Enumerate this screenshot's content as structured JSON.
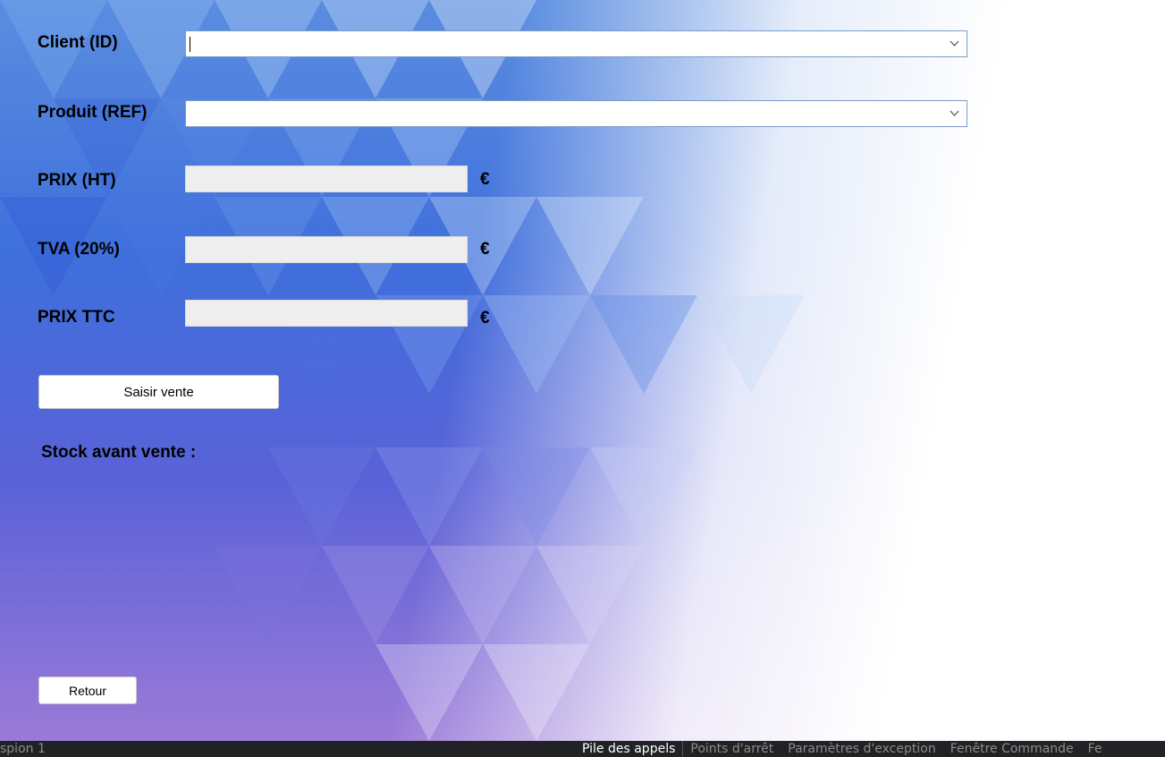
{
  "form": {
    "client_label": "Client (ID)",
    "client_value": "",
    "produit_label": "Produit (REF)",
    "produit_value": "",
    "prix_ht_label": "PRIX (HT)",
    "prix_ht_value": "",
    "tva_label": "TVA (20%)",
    "tva_value": "",
    "prix_ttc_label": "PRIX TTC",
    "prix_ttc_value": "",
    "currency": "€",
    "saisir_button": "Saisir vente",
    "stock_label": "Stock avant vente :",
    "retour_button": "Retour"
  },
  "statusbar": {
    "left_text": "spion 1",
    "tabs": [
      "Pile des appels",
      "Points d'arrêt",
      "Paramètres d'exception",
      "Fenêtre Commande",
      "Fe"
    ]
  },
  "colors": {
    "blue": "#3f6fdc",
    "violet": "#9b7ad8",
    "statusbar": "#202225"
  }
}
